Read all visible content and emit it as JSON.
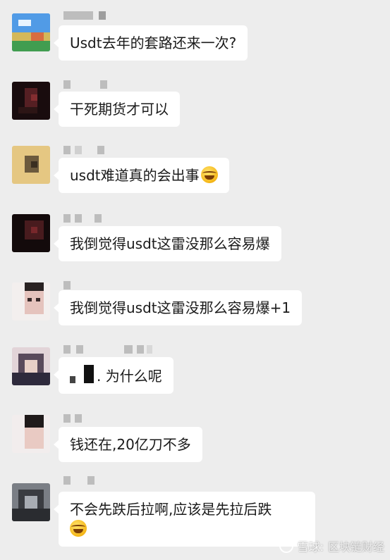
{
  "messages": [
    {
      "text": "Usdt去年的套路还来一次?"
    },
    {
      "text": "干死期货才可以"
    },
    {
      "text": "usdt难道真的会出事",
      "emoji": "rolling-laughing-emoji"
    },
    {
      "text": "我倒觉得usdt这雷没那么容易爆"
    },
    {
      "text": "我倒觉得usdt这雷没那么容易爆+1"
    },
    {
      "text": ". 为什么呢"
    },
    {
      "text": "钱还在,20亿刀不多"
    },
    {
      "text": "不会先跌后拉啊,应该是先拉后跌",
      "emoji": "tears-of-joy-emoji"
    }
  ],
  "footer": {
    "left": "雪球:",
    "right": "区块链财经"
  }
}
